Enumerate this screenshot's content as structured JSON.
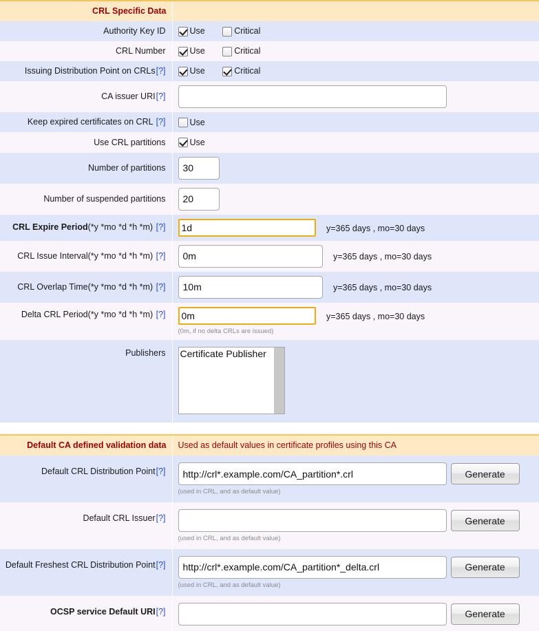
{
  "colors": {
    "section_header_bg": "#fde9c4",
    "section_header_text": "#9b0000",
    "row_alt_blue": "#dfe6fa",
    "row_alt_white": "#faf5fa",
    "highlight_border": "#efad10",
    "help_link": "#2a4ec4"
  },
  "crl_section": {
    "header_label": "CRL Specific Data",
    "header_note": "",
    "rows": {
      "authority_key_id": {
        "label": "Authority Key ID",
        "use_label": "Use",
        "use_checked": true,
        "critical_label": "Critical",
        "critical_checked": false
      },
      "crl_number": {
        "label": "CRL Number",
        "use_label": "Use",
        "use_checked": true,
        "critical_label": "Critical",
        "critical_checked": false
      },
      "issuing_dp": {
        "label": "Issuing Distribution Point on CRLs",
        "help": "[?]",
        "use_label": "Use",
        "use_checked": true,
        "critical_label": "Critical",
        "critical_checked": true
      },
      "ca_issuer_uri": {
        "label": "CA issuer URI",
        "help": "[?]",
        "value": "",
        "placeholder": ""
      },
      "keep_expired": {
        "label": "Keep expired certificates on CRL",
        "help": "[?]",
        "use_label": "Use",
        "use_checked": false
      },
      "use_partitions": {
        "label": "Use CRL partitions",
        "use_label": "Use",
        "use_checked": true
      },
      "number_of_partitions": {
        "label": "Number of partitions",
        "value": "30"
      },
      "number_of_suspended_partitions": {
        "label": "Number of suspended partitions",
        "value": "20"
      },
      "crl_expire_period": {
        "label_strong": "CRL Expire Period",
        "label_suffix": "(*y *mo *d *h *m)",
        "help": "[?]",
        "value": "1d",
        "unit_note": "y=365 days , mo=30 days",
        "highlighted": true
      },
      "crl_issue_interval": {
        "label_strong": "",
        "label_suffix": "CRL Issue Interval(*y *mo *d *h *m)",
        "help": "[?]",
        "value": "0m",
        "unit_note": "y=365 days , mo=30 days",
        "highlighted": false
      },
      "crl_overlap_time": {
        "label_strong": "",
        "label_suffix": "CRL Overlap Time(*y *mo *d *h *m)",
        "help": "[?]",
        "value": "10m",
        "unit_note": "y=365 days , mo=30 days",
        "highlighted": false
      },
      "delta_crl_period": {
        "label_strong": "",
        "label_suffix": "Delta CRL Period(*y *mo *d *h *m)",
        "help": "[?]",
        "value": "0m",
        "unit_note": "y=365 days , mo=30 days",
        "sub_note": "(0m, if no delta CRLs are issued)",
        "highlighted": true
      },
      "publishers": {
        "label": "Publishers",
        "options": [
          "Certificate Publisher"
        ]
      }
    }
  },
  "validation_section": {
    "header_label": "Default CA defined validation data",
    "header_note": "Used as default values in certificate profiles using this CA",
    "rows": {
      "default_crl_dp": {
        "label": "Default CRL Distribution Point",
        "help": "[?]",
        "value": "http://crl*.example.com/CA_partition*.crl",
        "button": "Generate",
        "sub_note": "(used in CRL, and as default value)"
      },
      "default_crl_issuer": {
        "label": "Default CRL Issuer",
        "help": "[?]",
        "value": "",
        "button": "Generate",
        "sub_note": "(used in CRL, and as default value)"
      },
      "default_freshest_crl_dp": {
        "label": "Default Freshest CRL Distribution Point",
        "help": "[?]",
        "value": "http://crl*.example.com/CA_partition*_delta.crl",
        "button": "Generate",
        "sub_note": "(used in CRL, and as default value)"
      },
      "ocsp_default_uri": {
        "label": "OCSP service Default URI",
        "help": "[?]",
        "value": "",
        "button": "Generate",
        "sub_note": ""
      }
    }
  }
}
